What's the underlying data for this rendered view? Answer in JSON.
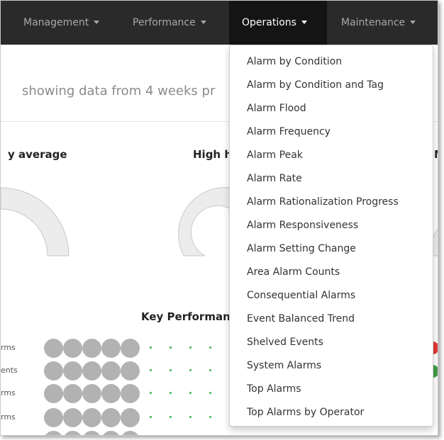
{
  "navbar": {
    "items": [
      {
        "label": "Management",
        "active": false
      },
      {
        "label": "Performance",
        "active": false
      },
      {
        "label": "Operations",
        "active": true
      },
      {
        "label": "Maintenance",
        "active": false
      }
    ]
  },
  "header": {
    "subtitle": "showing data from 4 weeks pr",
    "subtitle_tail": ":("
  },
  "gauges": {
    "titles": [
      "y average",
      "High h",
      "M"
    ]
  },
  "kpi": {
    "title": "Key Performanc",
    "rows": [
      {
        "label": "rms"
      },
      {
        "label": "ents"
      },
      {
        "label": "rms"
      },
      {
        "label": "rms"
      }
    ],
    "status_colors": {
      "red": "#e53935",
      "green": "#43a047"
    }
  },
  "operations_menu": {
    "items": [
      "Alarm by Condition",
      "Alarm by Condition and Tag",
      "Alarm Flood",
      "Alarm Frequency",
      "Alarm Peak",
      "Alarm Rate",
      "Alarm Rationalization Progress",
      "Alarm Responsiveness",
      "Alarm Setting Change",
      "Area Alarm Counts",
      "Consequential Alarms",
      "Event Balanced Trend",
      "Shelved Events",
      "System Alarms",
      "Top Alarms",
      "Top Alarms by Operator"
    ]
  },
  "colors": {
    "navbar_bg": "#2a2a2a",
    "navbar_active_bg": "#141414",
    "gauge_fill": "#ececec",
    "gauge_stroke": "#c8c8c8",
    "kpi_circle": "#b2b2b2"
  }
}
